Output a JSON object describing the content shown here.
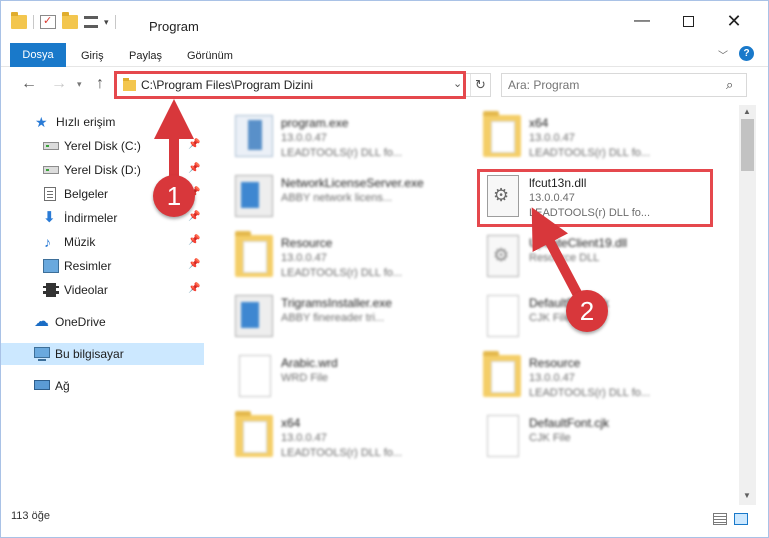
{
  "window": {
    "title": "Program",
    "controls": {
      "minimize": "—",
      "close": "✕"
    }
  },
  "ribbon": {
    "tabs": [
      "Dosya",
      "Giriş",
      "Paylaş",
      "Görünüm"
    ],
    "help": "?"
  },
  "navigation": {
    "address": "C:\\Program Files\\Program Dizini",
    "search_placeholder": "Ara: Program"
  },
  "sidebar": {
    "items": [
      {
        "label": "Hızlı erişim",
        "icon": "star-icon"
      },
      {
        "label": "Yerel Disk (C:)",
        "icon": "disk-icon",
        "pinned": true
      },
      {
        "label": "Yerel Disk (D:)",
        "icon": "disk-icon",
        "pinned": true
      },
      {
        "label": "Belgeler",
        "icon": "documents-icon",
        "pinned": true
      },
      {
        "label": "İndirmeler",
        "icon": "downloads-icon",
        "pinned": true
      },
      {
        "label": "Müzik",
        "icon": "music-icon",
        "pinned": true
      },
      {
        "label": "Resimler",
        "icon": "pictures-icon",
        "pinned": true
      },
      {
        "label": "Videolar",
        "icon": "videos-icon",
        "pinned": true
      },
      {
        "label": "OneDrive",
        "icon": "onedrive-icon"
      },
      {
        "label": "Bu bilgisayar",
        "icon": "computer-icon",
        "selected": true
      },
      {
        "label": "Ağ",
        "icon": "network-icon"
      }
    ]
  },
  "files": [
    {
      "name": "program.exe",
      "line2": "13.0.0.47",
      "line3": "LEADTOOLS(r) DLL fo...",
      "icon": "exe-icon"
    },
    {
      "name": "x64",
      "line2": "13.0.0.47",
      "line3": "LEADTOOLS(r) DLL fo...",
      "icon": "folder-icon"
    },
    {
      "name": "NetworkLicenseServer.exe",
      "line2": "ABBY network licens...",
      "line3": "",
      "icon": "exe-icon"
    },
    {
      "name": "lfcut13n.dll",
      "line2": "13.0.0.47",
      "line3": "LEADTOOLS(r) DLL fo...",
      "icon": "dll-gear-icon"
    },
    {
      "name": "Resource",
      "line2": "13.0.0.47",
      "line3": "LEADTOOLS(r) DLL fo...",
      "icon": "folder-icon"
    },
    {
      "name": "UpdateClient19.dll",
      "line2": "Resource DLL",
      "line3": "",
      "icon": "dll-gear-icon"
    },
    {
      "name": "TrigramsInstaller.exe",
      "line2": "ABBY finereader tri...",
      "line3": "",
      "icon": "exe-icon"
    },
    {
      "name": "DefaultFont.cjk",
      "line2": "CJK File",
      "line3": "",
      "icon": "file-icon"
    },
    {
      "name": "Arabic.wrd",
      "line2": "WRD File",
      "line3": "",
      "icon": "file-icon"
    },
    {
      "name": "Resource",
      "line2": "13.0.0.47",
      "line3": "LEADTOOLS(r) DLL fo...",
      "icon": "folder-icon"
    },
    {
      "name": "x64",
      "line2": "13.0.0.47",
      "line3": "LEADTOOLS(r) DLL fo...",
      "icon": "folder-icon"
    },
    {
      "name": "DefaultFont.cjk",
      "line2": "CJK File",
      "line3": "",
      "icon": "file-icon"
    }
  ],
  "status": {
    "item_count": "113 öğe"
  },
  "annotations": {
    "step1": "1",
    "step2": "2",
    "color": "#d8373b"
  },
  "colors": {
    "accent": "#1979ca",
    "highlight": "#e5484d",
    "selection": "#cce8ff"
  }
}
